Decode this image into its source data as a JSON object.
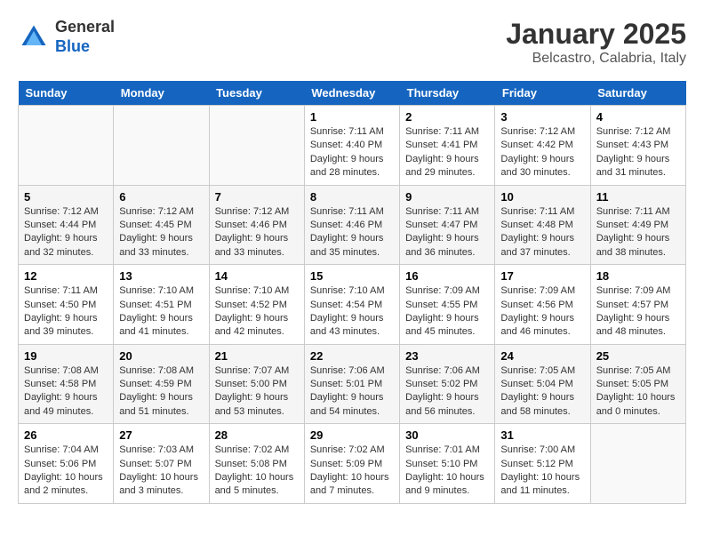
{
  "header": {
    "logo_general": "General",
    "logo_blue": "Blue",
    "title": "January 2025",
    "subtitle": "Belcastro, Calabria, Italy"
  },
  "days_of_week": [
    "Sunday",
    "Monday",
    "Tuesday",
    "Wednesday",
    "Thursday",
    "Friday",
    "Saturday"
  ],
  "weeks": [
    [
      {
        "day": "",
        "info": ""
      },
      {
        "day": "",
        "info": ""
      },
      {
        "day": "",
        "info": ""
      },
      {
        "day": "1",
        "info": "Sunrise: 7:11 AM\nSunset: 4:40 PM\nDaylight: 9 hours and 28 minutes."
      },
      {
        "day": "2",
        "info": "Sunrise: 7:11 AM\nSunset: 4:41 PM\nDaylight: 9 hours and 29 minutes."
      },
      {
        "day": "3",
        "info": "Sunrise: 7:12 AM\nSunset: 4:42 PM\nDaylight: 9 hours and 30 minutes."
      },
      {
        "day": "4",
        "info": "Sunrise: 7:12 AM\nSunset: 4:43 PM\nDaylight: 9 hours and 31 minutes."
      }
    ],
    [
      {
        "day": "5",
        "info": "Sunrise: 7:12 AM\nSunset: 4:44 PM\nDaylight: 9 hours and 32 minutes."
      },
      {
        "day": "6",
        "info": "Sunrise: 7:12 AM\nSunset: 4:45 PM\nDaylight: 9 hours and 33 minutes."
      },
      {
        "day": "7",
        "info": "Sunrise: 7:12 AM\nSunset: 4:46 PM\nDaylight: 9 hours and 33 minutes."
      },
      {
        "day": "8",
        "info": "Sunrise: 7:11 AM\nSunset: 4:46 PM\nDaylight: 9 hours and 35 minutes."
      },
      {
        "day": "9",
        "info": "Sunrise: 7:11 AM\nSunset: 4:47 PM\nDaylight: 9 hours and 36 minutes."
      },
      {
        "day": "10",
        "info": "Sunrise: 7:11 AM\nSunset: 4:48 PM\nDaylight: 9 hours and 37 minutes."
      },
      {
        "day": "11",
        "info": "Sunrise: 7:11 AM\nSunset: 4:49 PM\nDaylight: 9 hours and 38 minutes."
      }
    ],
    [
      {
        "day": "12",
        "info": "Sunrise: 7:11 AM\nSunset: 4:50 PM\nDaylight: 9 hours and 39 minutes."
      },
      {
        "day": "13",
        "info": "Sunrise: 7:10 AM\nSunset: 4:51 PM\nDaylight: 9 hours and 41 minutes."
      },
      {
        "day": "14",
        "info": "Sunrise: 7:10 AM\nSunset: 4:52 PM\nDaylight: 9 hours and 42 minutes."
      },
      {
        "day": "15",
        "info": "Sunrise: 7:10 AM\nSunset: 4:54 PM\nDaylight: 9 hours and 43 minutes."
      },
      {
        "day": "16",
        "info": "Sunrise: 7:09 AM\nSunset: 4:55 PM\nDaylight: 9 hours and 45 minutes."
      },
      {
        "day": "17",
        "info": "Sunrise: 7:09 AM\nSunset: 4:56 PM\nDaylight: 9 hours and 46 minutes."
      },
      {
        "day": "18",
        "info": "Sunrise: 7:09 AM\nSunset: 4:57 PM\nDaylight: 9 hours and 48 minutes."
      }
    ],
    [
      {
        "day": "19",
        "info": "Sunrise: 7:08 AM\nSunset: 4:58 PM\nDaylight: 9 hours and 49 minutes."
      },
      {
        "day": "20",
        "info": "Sunrise: 7:08 AM\nSunset: 4:59 PM\nDaylight: 9 hours and 51 minutes."
      },
      {
        "day": "21",
        "info": "Sunrise: 7:07 AM\nSunset: 5:00 PM\nDaylight: 9 hours and 53 minutes."
      },
      {
        "day": "22",
        "info": "Sunrise: 7:06 AM\nSunset: 5:01 PM\nDaylight: 9 hours and 54 minutes."
      },
      {
        "day": "23",
        "info": "Sunrise: 7:06 AM\nSunset: 5:02 PM\nDaylight: 9 hours and 56 minutes."
      },
      {
        "day": "24",
        "info": "Sunrise: 7:05 AM\nSunset: 5:04 PM\nDaylight: 9 hours and 58 minutes."
      },
      {
        "day": "25",
        "info": "Sunrise: 7:05 AM\nSunset: 5:05 PM\nDaylight: 10 hours and 0 minutes."
      }
    ],
    [
      {
        "day": "26",
        "info": "Sunrise: 7:04 AM\nSunset: 5:06 PM\nDaylight: 10 hours and 2 minutes."
      },
      {
        "day": "27",
        "info": "Sunrise: 7:03 AM\nSunset: 5:07 PM\nDaylight: 10 hours and 3 minutes."
      },
      {
        "day": "28",
        "info": "Sunrise: 7:02 AM\nSunset: 5:08 PM\nDaylight: 10 hours and 5 minutes."
      },
      {
        "day": "29",
        "info": "Sunrise: 7:02 AM\nSunset: 5:09 PM\nDaylight: 10 hours and 7 minutes."
      },
      {
        "day": "30",
        "info": "Sunrise: 7:01 AM\nSunset: 5:10 PM\nDaylight: 10 hours and 9 minutes."
      },
      {
        "day": "31",
        "info": "Sunrise: 7:00 AM\nSunset: 5:12 PM\nDaylight: 10 hours and 11 minutes."
      },
      {
        "day": "",
        "info": ""
      }
    ]
  ]
}
